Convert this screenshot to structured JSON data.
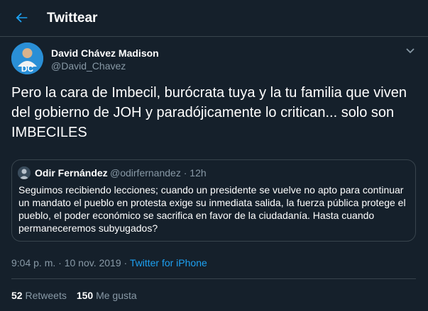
{
  "colors": {
    "background": "#15202b",
    "accent": "#1da1f2",
    "muted": "#8899a6",
    "border": "#38444d"
  },
  "header": {
    "title": "Twittear",
    "back_icon": "arrow-left-icon"
  },
  "tweet": {
    "author": {
      "name": "David Chávez Madison",
      "handle": "@David_Chavez",
      "avatar_initials": "DC"
    },
    "more_icon": "chevron-down-icon",
    "text": "Pero la cara de Imbecil, burócrata tuya y la tu familia que viven del gobierno de JOH y paradójicamente lo critican... solo son IMBECILES",
    "quote": {
      "name": "Odir Fernández",
      "handle": "@odirfernandez",
      "separator": "·",
      "time": "12h",
      "text": "Seguimos recibiendo lecciones; cuando un presidente se vuelve no apto para continuar un mandato el pueblo en protesta exige su inmediata salida, la fuerza pública protege el pueblo, el poder económico se sacrifica en favor de la ciudadanía. Hasta cuando permaneceremos subyugados?"
    },
    "timestamp": "9:04 p. m. · 10 nov. 2019",
    "separator": " · ",
    "source": "Twitter for iPhone",
    "stats": {
      "retweets_count": "52",
      "retweets_label": "Retweets",
      "likes_count": "150",
      "likes_label": "Me gusta"
    }
  }
}
